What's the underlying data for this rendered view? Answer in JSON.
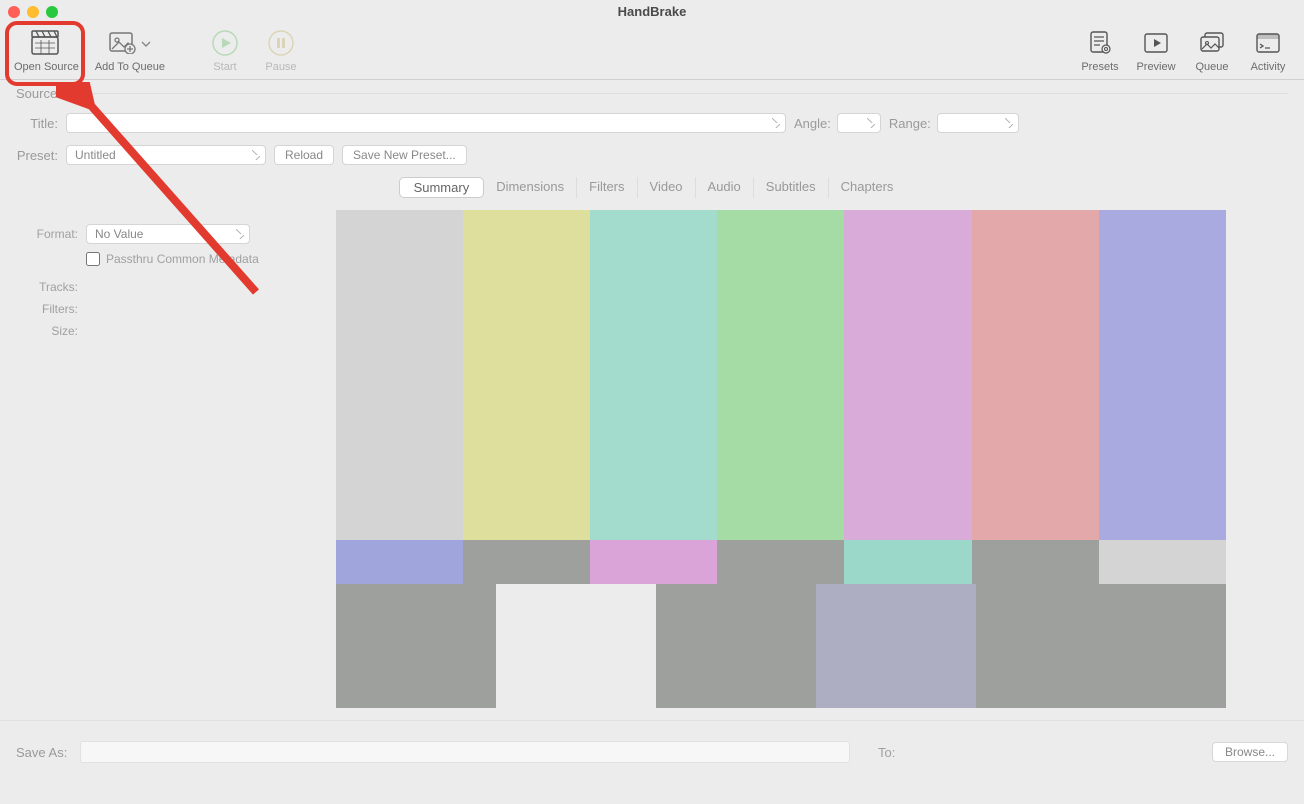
{
  "window": {
    "title": "HandBrake"
  },
  "toolbar": {
    "open_source": "Open Source",
    "add_to_queue": "Add To Queue",
    "start": "Start",
    "pause": "Pause",
    "presets": "Presets",
    "preview": "Preview",
    "queue": "Queue",
    "activity": "Activity"
  },
  "labels": {
    "source": "Source:",
    "title": "Title:",
    "angle": "Angle:",
    "range": "Range:",
    "preset": "Preset:",
    "format": "Format:",
    "tracks": "Tracks:",
    "filters": "Filters:",
    "size": "Size:",
    "saveas": "Save As:",
    "to": "To:"
  },
  "preset": {
    "value": "Untitled",
    "reload": "Reload",
    "save_new": "Save New Preset..."
  },
  "tabs": [
    "Summary",
    "Dimensions",
    "Filters",
    "Video",
    "Audio",
    "Subtitles",
    "Chapters"
  ],
  "summary": {
    "format_value": "No Value",
    "passthru": "Passthru Common Metadata"
  },
  "browse": "Browse...",
  "preview_colors": {
    "row1": [
      "#d4d4d4",
      "#dede9d",
      "#a3dccd",
      "#a5dba5",
      "#d9abd8",
      "#e3a8a9",
      "#a8aae0"
    ],
    "row2": [
      "#a0a5db",
      "#9da09d",
      "#daa4d9",
      "#9da09d",
      "#9cd8ca",
      "#9da09d",
      "#d4d4d4"
    ],
    "row3": [
      "#9da09d",
      "#ececec",
      "#9da09d",
      "#aeaec2",
      "#9da09d",
      "#9da09d",
      "#9da09d"
    ]
  }
}
